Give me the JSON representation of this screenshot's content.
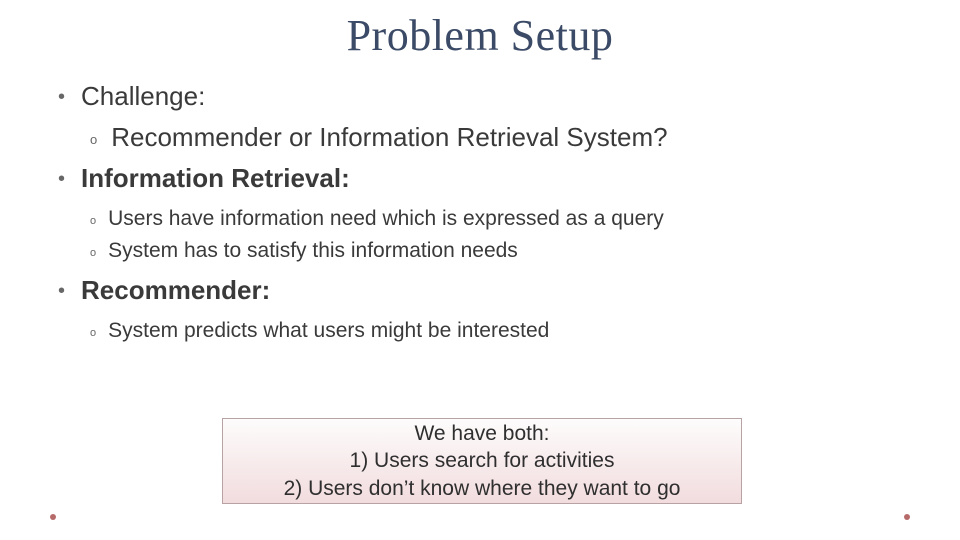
{
  "title": "Problem Setup",
  "bullets": {
    "challenge": {
      "label": "Challenge:",
      "sub": [
        "Recommender or Information Retrieval System?"
      ]
    },
    "ir": {
      "label": "Information Retrieval:",
      "sub": [
        "Users have information need which is expressed as a query",
        "System has to satisfy this information needs"
      ]
    },
    "recommender": {
      "label": "Recommender:",
      "sub": [
        "System predicts what users might be interested"
      ]
    }
  },
  "callout": {
    "line1": "We have both:",
    "line2": "1)  Users search for activities",
    "line3": "2)  Users don’t know where they want to go"
  }
}
